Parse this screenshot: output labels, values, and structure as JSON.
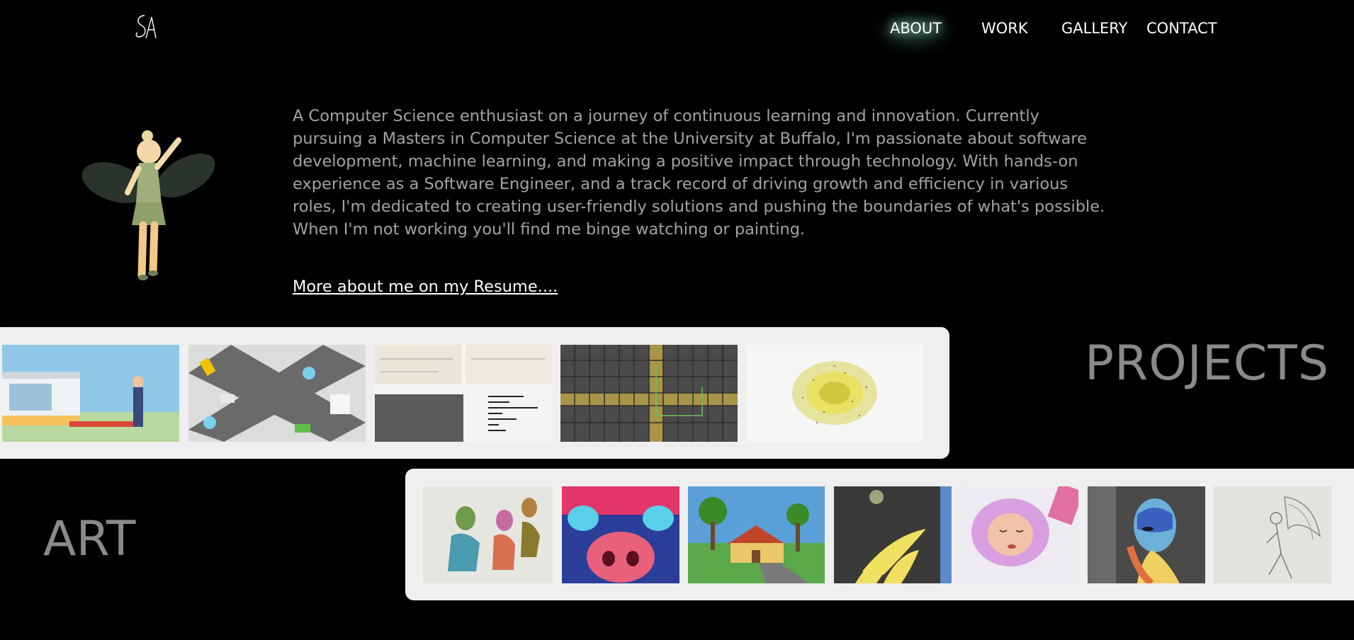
{
  "logo": {
    "icon": "sa-signature-logo-icon"
  },
  "nav": {
    "about": "ABOUT",
    "work": "WORK",
    "gallery": "GALLERY",
    "contact": "CONTACT"
  },
  "about": {
    "bio": "A Computer Science enthusiast on a journey of continuous learning and innovation. Currently pursuing a Masters in Computer Science at the University at Buffalo, I'm passionate about software development, machine learning, and making a positive impact through technology. With hands-on experience as a Software Engineer, and a track record of driving growth and efficiency in various roles, I'm dedicated to creating user-friendly solutions and pushing the boundaries of what's possible. When I'm not working you'll find me binge watching or painting.",
    "resume_link": "More about me on my Resume...."
  },
  "projects": {
    "title": "PROJECTS"
  },
  "art": {
    "title": "ART"
  },
  "colors": {
    "background": "#000000",
    "panel": "#efefef",
    "bio_text": "#a3a3a3",
    "section_title": "#8a8a8a",
    "nav_glow": "#9fd8c8"
  }
}
